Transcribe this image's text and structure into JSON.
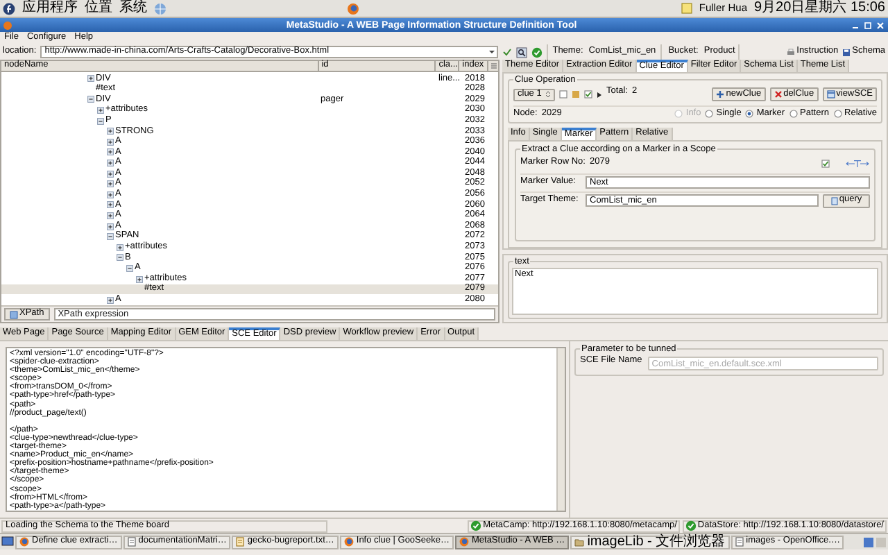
{
  "top_panel": {
    "menus": [
      "应用程序",
      "位置",
      "系统"
    ],
    "user": "Fuller Hua",
    "clock": "9月20日星期六 15:06"
  },
  "window": {
    "title": "MetaStudio - A WEB Page Information Structure Definition Tool"
  },
  "menu": [
    "File",
    "Configure",
    "Help"
  ],
  "location": {
    "label": "location:",
    "value": "http://www.made-in-china.com/Arts-Crafts-Catalog/Decorative-Box.html",
    "theme_label": "Theme:",
    "theme": "ComList_mic_en",
    "bucket_label": "Bucket:",
    "bucket": "Product",
    "buttons": [
      "Instruction",
      "Schema"
    ]
  },
  "tree": {
    "columns": [
      "nodeName",
      "id",
      "cla...",
      "index"
    ],
    "nodes": [
      {
        "name": "DIV",
        "class": "line...",
        "index": "2018",
        "expanded": false,
        "selected": false
      },
      {
        "name": "#text",
        "index": "2028",
        "selected": false
      },
      {
        "name": "DIV",
        "id": "pager",
        "index": "2029",
        "expanded": true,
        "selected": false,
        "children": [
          {
            "name": "+attributes",
            "index": "2030",
            "expanded": false,
            "selected": false
          },
          {
            "name": "P",
            "index": "2032",
            "expanded": true,
            "selected": false,
            "children": [
              {
                "name": "STRONG",
                "index": "2033",
                "expanded": false,
                "selected": false
              },
              {
                "name": "A",
                "index": "2036",
                "expanded": false,
                "selected": false
              },
              {
                "name": "A",
                "index": "2040",
                "expanded": false,
                "selected": false
              },
              {
                "name": "A",
                "index": "2044",
                "expanded": false,
                "selected": false
              },
              {
                "name": "A",
                "index": "2048",
                "expanded": false,
                "selected": false
              },
              {
                "name": "A",
                "index": "2052",
                "expanded": false,
                "selected": false
              },
              {
                "name": "A",
                "index": "2056",
                "expanded": false,
                "selected": false
              },
              {
                "name": "A",
                "index": "2060",
                "expanded": false,
                "selected": false
              },
              {
                "name": "A",
                "index": "2064",
                "expanded": false,
                "selected": false
              },
              {
                "name": "A",
                "index": "2068",
                "expanded": false,
                "selected": false
              },
              {
                "name": "SPAN",
                "index": "2072",
                "expanded": true,
                "selected": false,
                "children": [
                  {
                    "name": "+attributes",
                    "index": "2073",
                    "expanded": false,
                    "selected": false
                  },
                  {
                    "name": "B",
                    "index": "2075",
                    "expanded": true,
                    "selected": false,
                    "children": [
                      {
                        "name": "A",
                        "index": "2076",
                        "expanded": true,
                        "selected": false,
                        "children": [
                          {
                            "name": "+attributes",
                            "index": "2077",
                            "expanded": false,
                            "selected": false
                          },
                          {
                            "name": "#text",
                            "index": "2079",
                            "selected": true
                          }
                        ]
                      }
                    ]
                  }
                ]
              },
              {
                "name": "A",
                "index": "2080",
                "expanded": false,
                "selected": false
              }
            ]
          }
        ]
      }
    ]
  },
  "xpath": {
    "button": "XPath",
    "placeholder": "XPath expression"
  },
  "editor_tabs": [
    {
      "label": "Theme Editor",
      "selected": false
    },
    {
      "label": "Extraction Editor",
      "selected": false
    },
    {
      "label": "Clue Editor",
      "selected": true
    },
    {
      "label": "Filter Editor",
      "selected": false
    },
    {
      "label": "Schema List",
      "selected": false
    },
    {
      "label": "Theme List",
      "selected": false
    }
  ],
  "clue_operation": {
    "title": "Clue Operation",
    "clue": "clue 1",
    "checkboxes": [
      {
        "checked": false
      },
      {
        "checked": true
      }
    ],
    "total_label": "Total:",
    "total": "2",
    "buttons": [
      "newClue",
      "delClue",
      "viewSCE"
    ],
    "node_label": "Node:",
    "node": "2029",
    "modes": [
      {
        "label": "Info",
        "selected": false,
        "disabled": true
      },
      {
        "label": "Single",
        "selected": false,
        "disabled": false
      },
      {
        "label": "Marker",
        "selected": true,
        "disabled": false
      },
      {
        "label": "Pattern",
        "selected": false,
        "disabled": false
      },
      {
        "label": "Relative",
        "selected": false,
        "disabled": false
      }
    ]
  },
  "clue_tabs": [
    {
      "label": "Info",
      "selected": false
    },
    {
      "label": "Single",
      "selected": false
    },
    {
      "label": "Marker",
      "selected": true
    },
    {
      "label": "Pattern",
      "selected": false
    },
    {
      "label": "Relative",
      "selected": false
    }
  ],
  "marker": {
    "title": "Extract a Clue according on a Marker in a Scope",
    "row_label": "Marker Row No:",
    "row": "2079",
    "checked": true,
    "value_label": "Marker Value:",
    "value": "Next",
    "theme_label": "Target Theme:",
    "theme": "ComList_mic_en",
    "query": "query"
  },
  "text_panel": {
    "title": "text",
    "value": "Next"
  },
  "bottom_tabs": [
    {
      "label": "Web Page",
      "selected": false
    },
    {
      "label": "Page Source",
      "selected": false
    },
    {
      "label": "Mapping Editor",
      "selected": false
    },
    {
      "label": "GEM Editor",
      "selected": false
    },
    {
      "label": "SCE Editor",
      "selected": true
    },
    {
      "label": "DSD preview",
      "selected": false
    },
    {
      "label": "Workflow preview",
      "selected": false
    },
    {
      "label": "Error",
      "selected": false
    },
    {
      "label": "Output",
      "selected": false
    }
  ],
  "sce_source": "<?xml version=\"1.0\" encoding=\"UTF-8\"?>\n<spider-clue-extraction>\n<theme>ComList_mic_en</theme>\n<scope>\n<from>transDOM_0</from>\n<path-type>href</path-type>\n<path>\n//product_page/text()\n\n</path>\n<clue-type>newthread</clue-type>\n<target-theme>\n<name>Product_mic_en</name>\n<prefix-position>hostname+pathname</prefix-position>\n</target-theme>\n</scope>\n<scope>\n<from>HTML</from>\n<path-type>a</path-type>",
  "parameters": {
    "title": "Parameter to be tunned",
    "file_label": "SCE File Name",
    "file": "ComList_mic_en.default.sce.xml",
    "disabled": true
  },
  "status_bar": {
    "message": "Loading the Schema to the Theme board",
    "servers": [
      "MetaCamp: http://192.168.1.10:8080/metacamp/",
      "DataStore: http://192.168.1.10:8080/datastore/"
    ]
  },
  "taskbar": [
    {
      "label": "Define clue extracti…",
      "kind": "browser",
      "selected": false
    },
    {
      "label": "documentationMatri…",
      "kind": "document",
      "selected": false
    },
    {
      "label": "gecko-bugreport.txt…",
      "kind": "text",
      "selected": false
    },
    {
      "label": "Info clue | GooSeeke…",
      "kind": "browser",
      "selected": false
    },
    {
      "label": "MetaStudio - A WEB …",
      "kind": "browser",
      "selected": true
    },
    {
      "label": "imageLib - 文件浏览器",
      "kind": "folder",
      "selected": false
    },
    {
      "label": "images - OpenOffice.…",
      "kind": "document",
      "selected": false
    }
  ]
}
